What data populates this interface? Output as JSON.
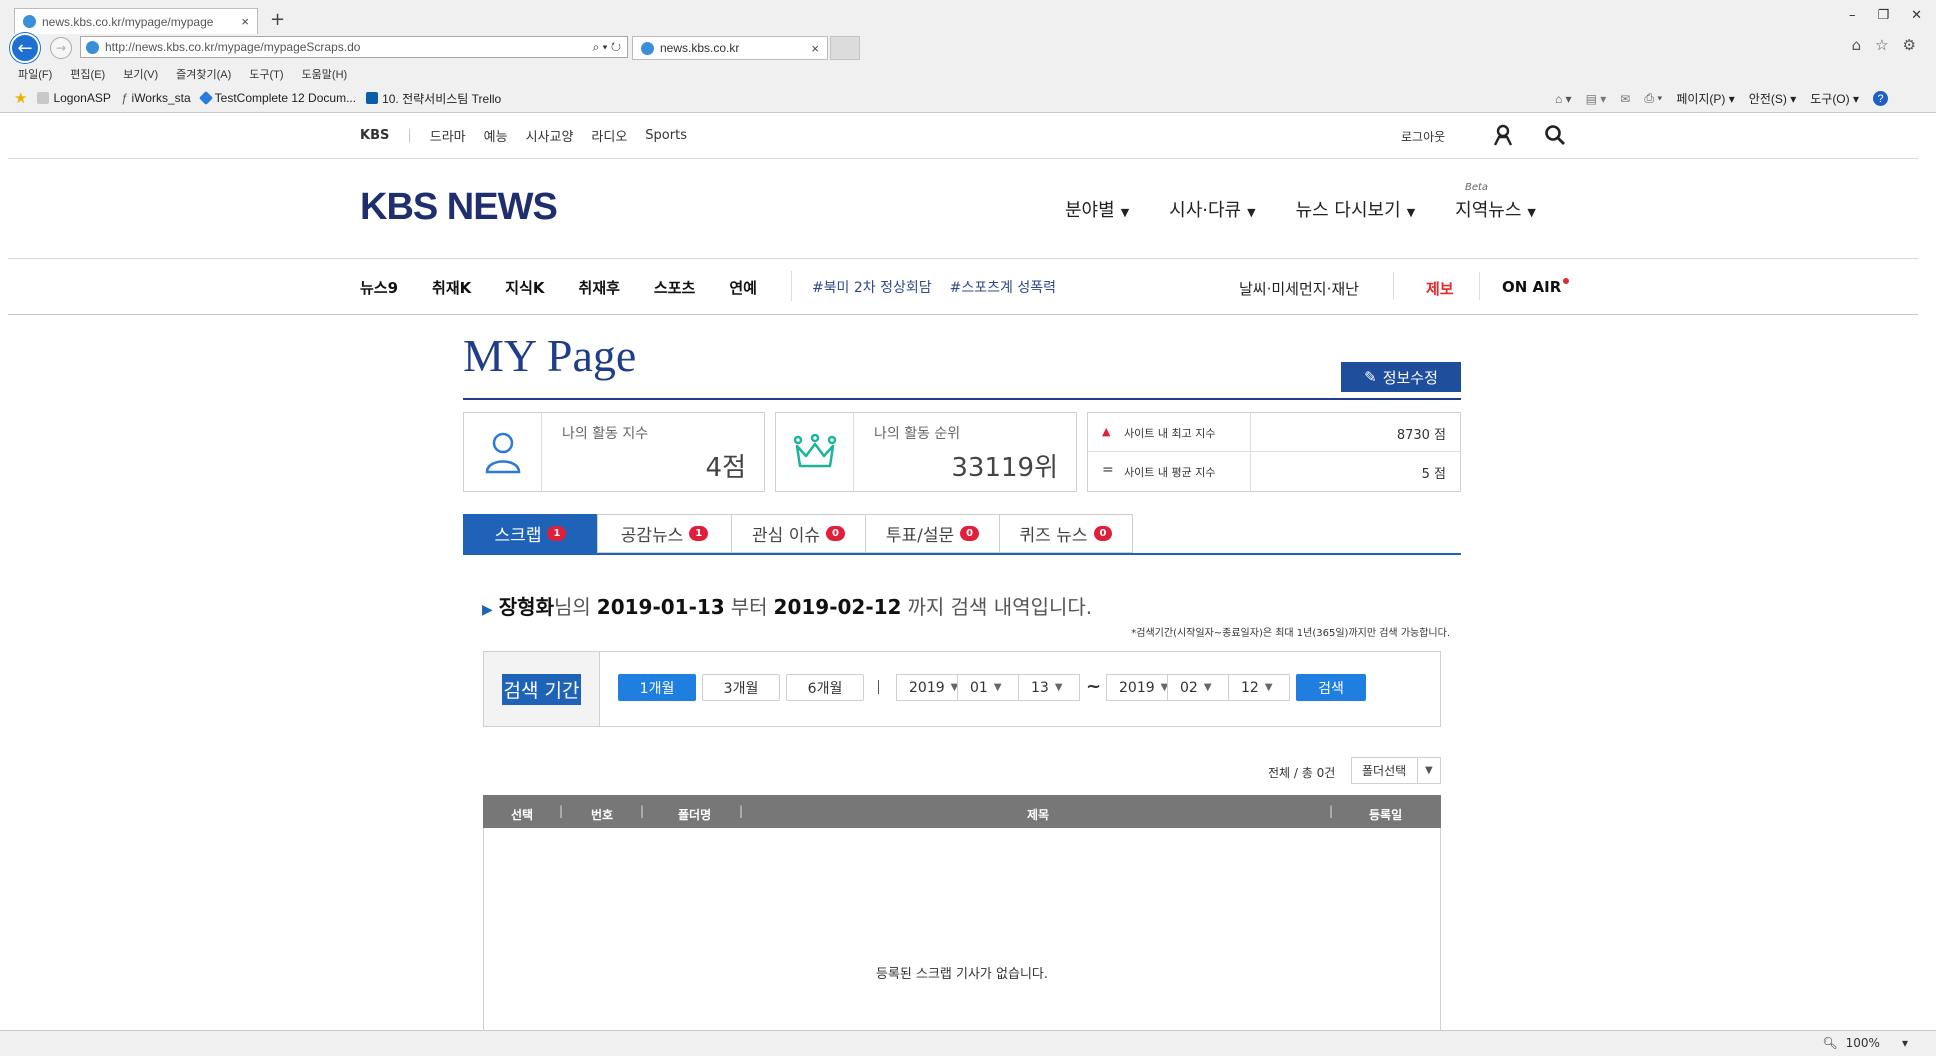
{
  "browser": {
    "tabs": [
      {
        "label": "news.kbs.co.kr/mypage/mypage"
      },
      {
        "label": "news.kbs.co.kr"
      }
    ],
    "new_tab_glyph": "+",
    "close_glyph": "×",
    "url": "http://news.kbs.co.kr/mypage/mypageScraps.do",
    "search_glyph": "⌕ ▾ ↻",
    "menu": [
      "파일(F)",
      "편집(E)",
      "보기(V)",
      "즐겨찾기(A)",
      "도구(T)",
      "도움말(H)"
    ],
    "favorites": [
      "LogonASP",
      "iWorks_sta",
      "TestComplete 12 Docum...",
      "10. 전략서비스팀  Trello"
    ],
    "tools": [
      "페이지(P) ▾",
      "안전(S) ▾",
      "도구(O) ▾"
    ],
    "zoom": "100%",
    "window_controls": [
      "–",
      "❐",
      "✕"
    ]
  },
  "kbs": {
    "top_links": [
      "KBS",
      "드라마",
      "예능",
      "시사교양",
      "라디오",
      "Sports"
    ],
    "logout": "로그아웃",
    "logo": "KBS NEWS",
    "gnb": [
      "분야별",
      "시사·다큐",
      "뉴스 다시보기",
      "지역뉴스"
    ],
    "beta": "Beta",
    "subnav": [
      "뉴스9",
      "취재K",
      "지식K",
      "취재후",
      "스포츠",
      "연예"
    ],
    "tags": [
      "#북미 2차 정상회담",
      "#스포츠계 성폭력"
    ],
    "right_links": {
      "weather": "날씨·미세먼지·재난",
      "report": "제보",
      "onair": "ON AIR"
    }
  },
  "mypage": {
    "title": "MY Page",
    "edit_button": "정보수정",
    "activity_index_label": "나의 활동 지수",
    "activity_index_value": "4점",
    "activity_rank_label": "나의 활동 순위",
    "activity_rank_value": "33119위",
    "site_max_label": "사이트 내 최고 지수",
    "site_max_value": "8730 점",
    "site_avg_label": "사이트 내 평균 지수",
    "site_avg_value": "5 점",
    "tabs": [
      {
        "label": "스크랩",
        "count": "1"
      },
      {
        "label": "공감뉴스",
        "count": "1"
      },
      {
        "label": "관심 이슈",
        "count": "0"
      },
      {
        "label": "투표/설문",
        "count": "0"
      },
      {
        "label": "퀴즈 뉴스",
        "count": "0"
      }
    ],
    "search_summary": {
      "name": "장형화",
      "p1": "님의",
      "from": "2019-01-13",
      "p2": "부터",
      "to": "2019-02-12",
      "p3": "까지 검색 내역입니다."
    },
    "search_note": "*검색기간(시작일자~종료일자)은 최대 1년(365일)까지만 검색 가능합니다.",
    "period_label": "검색 기간",
    "period_buttons": [
      "1개월",
      "3개월",
      "6개월"
    ],
    "start": {
      "year": "2019",
      "month": "01",
      "day": "13"
    },
    "end": {
      "year": "2019",
      "month": "02",
      "day": "12"
    },
    "tilde": "~",
    "search_button": "검색",
    "total_text": "전체 / 총",
    "total_count": "0건",
    "folder_select": "폴더선택",
    "table_headers": [
      "선택",
      "번호",
      "폴더명",
      "제목",
      "등록일"
    ],
    "empty_message": "등록된 스크랩 기사가 없습니다."
  },
  "colors": {
    "accent": "#1f63b8",
    "badge": "#e0203b",
    "header_bar": "#777777",
    "navy": "#1f3d8a"
  }
}
